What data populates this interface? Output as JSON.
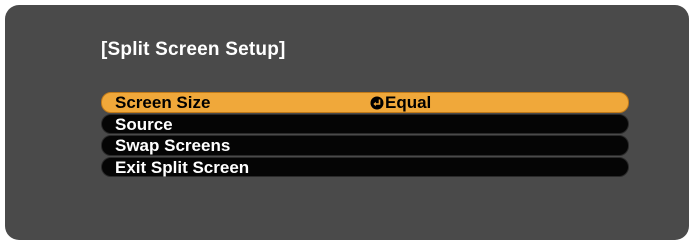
{
  "menu": {
    "title": "[Split Screen Setup]",
    "items": [
      {
        "label": "Screen Size",
        "value": "Equal",
        "selected": true,
        "value_icon": "enter-icon"
      },
      {
        "label": "Source",
        "value": "",
        "selected": false
      },
      {
        "label": "Swap Screens",
        "value": "",
        "selected": false
      },
      {
        "label": "Exit Split Screen",
        "value": "",
        "selected": false
      }
    ]
  },
  "colors": {
    "panel_background": "#4a4a4a",
    "row_background": "#050505",
    "selected_row": "#f0a83a",
    "text_light": "#ffffff",
    "text_dark": "#000000"
  }
}
